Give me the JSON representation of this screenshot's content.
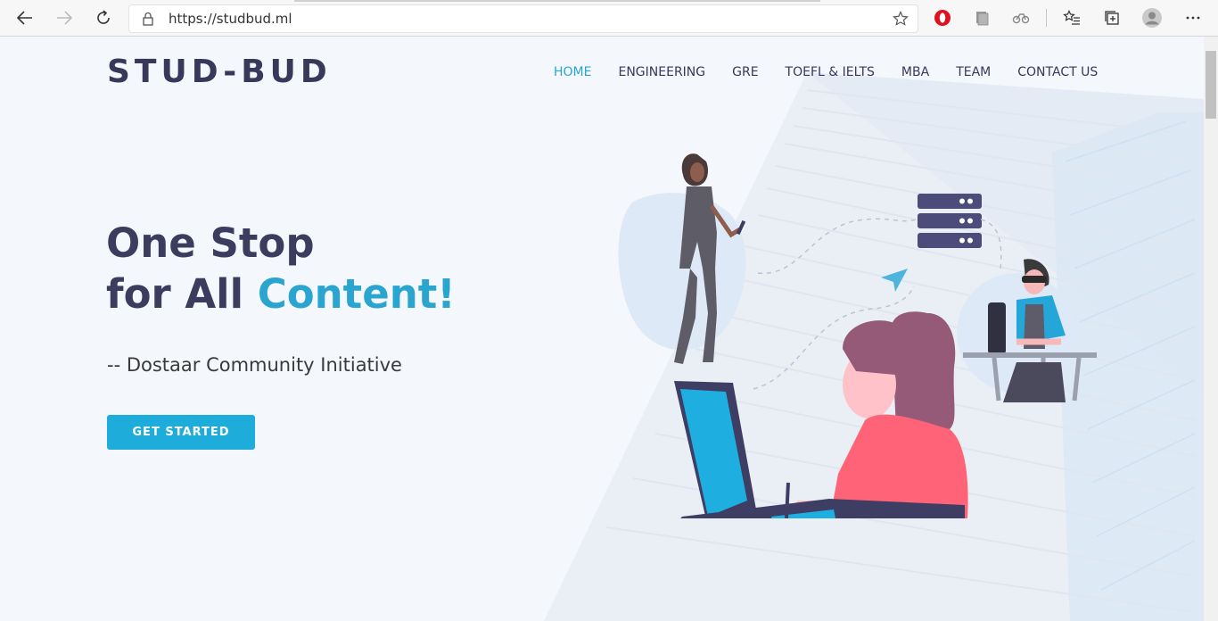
{
  "browser": {
    "url": "https://studbud.ml",
    "back_icon": "arrow-left-icon",
    "forward_icon": "arrow-right-icon",
    "refresh_icon": "refresh-icon",
    "lock_icon": "lock-icon",
    "favorite_icon": "star-icon",
    "extensions": [
      "opera-icon",
      "extension-icon",
      "tracker-icon"
    ],
    "tools": [
      "favorites-icon",
      "collections-icon",
      "profile-icon",
      "more-icon"
    ]
  },
  "site": {
    "logo": "STUD-BUD",
    "nav": [
      {
        "label": "HOME",
        "active": true
      },
      {
        "label": "ENGINEERING",
        "active": false
      },
      {
        "label": "GRE",
        "active": false
      },
      {
        "label": "TOEFL & IELTS",
        "active": false
      },
      {
        "label": "MBA",
        "active": false
      },
      {
        "label": "TEAM",
        "active": false
      },
      {
        "label": "CONTACT US",
        "active": false
      }
    ]
  },
  "hero": {
    "line1": "One Stop",
    "line2_prefix": "for All ",
    "line2_accent": "Content!",
    "tagline": "-- Dostaar Community Initiative",
    "cta": "GET STARTED"
  },
  "colors": {
    "accent": "#2aa5cf",
    "button": "#1eaddb",
    "heading": "#3b3c5e",
    "background": "#f4f7fc"
  }
}
